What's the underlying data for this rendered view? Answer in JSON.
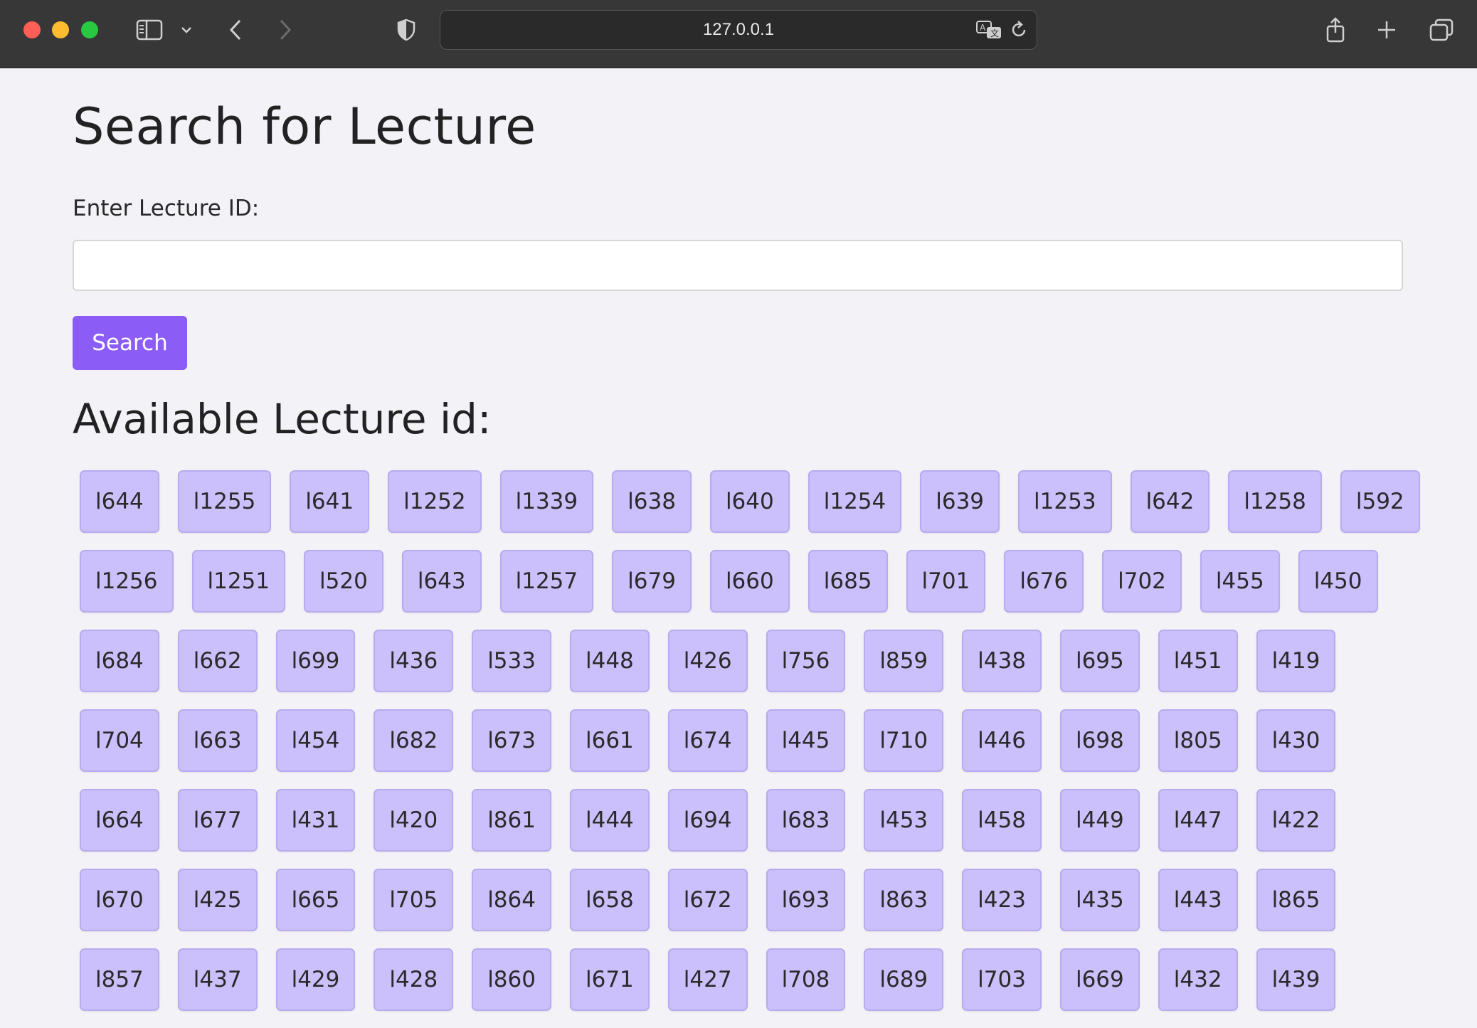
{
  "browser": {
    "url": "127.0.0.1"
  },
  "page": {
    "title": "Search for Lecture",
    "input_label": "Enter Lecture ID:",
    "input_value": "",
    "search_button": "Search",
    "available_heading": "Available Lecture id:"
  },
  "lecture_rows": [
    [
      "l644",
      "l1255",
      "l641",
      "l1252",
      "l1339",
      "l638",
      "l640",
      "l1254",
      "l639",
      "l1253",
      "l642",
      "l1258",
      "l592"
    ],
    [
      "l1256",
      "l1251",
      "l520",
      "l643",
      "l1257",
      "l679",
      "l660",
      "l685",
      "l701",
      "l676",
      "l702",
      "l455",
      "l450"
    ],
    [
      "l684",
      "l662",
      "l699",
      "l436",
      "l533",
      "l448",
      "l426",
      "l756",
      "l859",
      "l438",
      "l695",
      "l451",
      "l419"
    ],
    [
      "l704",
      "l663",
      "l454",
      "l682",
      "l673",
      "l661",
      "l674",
      "l445",
      "l710",
      "l446",
      "l698",
      "l805",
      "l430"
    ],
    [
      "l664",
      "l677",
      "l431",
      "l420",
      "l861",
      "l444",
      "l694",
      "l683",
      "l453",
      "l458",
      "l449",
      "l447",
      "l422"
    ],
    [
      "l670",
      "l425",
      "l665",
      "l705",
      "l864",
      "l658",
      "l672",
      "l693",
      "l863",
      "l423",
      "l435",
      "l443",
      "l865"
    ],
    [
      "l857",
      "l437",
      "l429",
      "l428",
      "l860",
      "l671",
      "l427",
      "l708",
      "l689",
      "l703",
      "l669",
      "l432",
      "l439"
    ]
  ],
  "colors": {
    "accent": "#8b5cf6",
    "chip_bg": "#cbc0fb",
    "page_bg": "#f3f2f7"
  },
  "icons": [
    "sidebar-icon",
    "chevron-down-icon",
    "back-icon",
    "forward-icon",
    "shield-icon",
    "translate-icon",
    "reload-icon",
    "share-icon",
    "new-tab-icon",
    "tabs-overview-icon"
  ]
}
